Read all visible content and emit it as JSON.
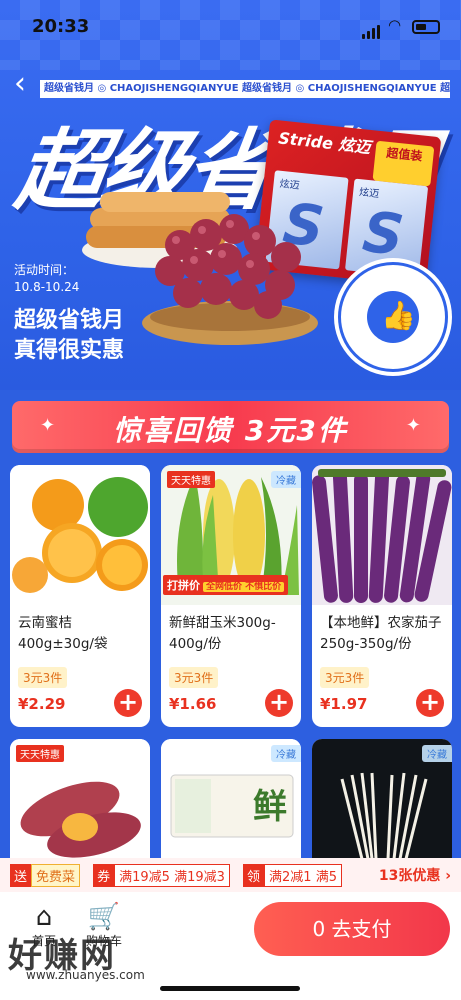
{
  "status_bar": {
    "time": "20:33"
  },
  "hero": {
    "ticker": "超级省钱月 ◎ CHAOJISHENGQIANYUE   超级省钱月 ◎ CHAOJISHENGQIANYUE   超级省钱月",
    "title": "超级省钱月",
    "activity_label": "活动时间：",
    "activity_dates": "10.8-10.24",
    "slogan_line1": "超级省钱月",
    "slogan_line2": "真得很实惠",
    "gum_brand": "Stride 炫迈",
    "gum_tag": "超值装",
    "gum_pack_label": "炫迈"
  },
  "promo_ribbon": {
    "text": "惊喜回馈  3元3件"
  },
  "products": [
    {
      "name": "云南蜜桔400g±30g/袋",
      "promo": "3元3件",
      "price": "¥2.29",
      "badge": "",
      "cold": ""
    },
    {
      "name": "新鲜甜玉米300g-400g/份",
      "promo": "3元3件",
      "price": "¥1.66",
      "badge": "天天特惠",
      "cold": "冷藏",
      "splash": "打拼价",
      "splash_note": "全网低价 不惧比价"
    },
    {
      "name": "【本地鲜】农家茄子250g-350g/份",
      "promo": "3元3件",
      "price": "¥1.97",
      "badge": "",
      "cold": ""
    },
    {
      "name": "",
      "promo": "",
      "price": "",
      "badge": "天天特惠",
      "cold": ""
    },
    {
      "name": "",
      "promo": "",
      "price": "",
      "badge": "",
      "cold": "冷藏",
      "label": "鲜"
    },
    {
      "name": "",
      "promo": "",
      "price": "",
      "badge": "",
      "cold": "冷藏"
    }
  ],
  "coupons": {
    "send_tag": "送",
    "send_val": "免费菜",
    "coupon_tag": "券",
    "coupon_val": "满19减5  满19减3",
    "get_tag": "领",
    "get_val": "满2减1  满5",
    "count": "13张优惠 ›"
  },
  "bottom_bar": {
    "nav1_label": "首页",
    "nav2_label": "购物车",
    "pay_label": "0 去支付"
  },
  "watermark": {
    "text": "好赚网",
    "url": "www.zhuanyes.com"
  },
  "colors": {
    "brand_blue": "#2f63e8",
    "accent_red": "#e8311f",
    "promo_yellow": "#fff2c9"
  }
}
